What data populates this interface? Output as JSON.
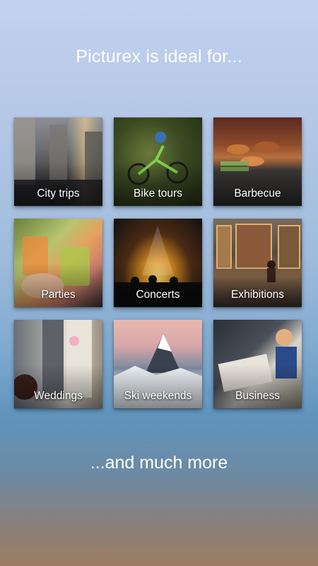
{
  "headline": "Picturex is ideal for...",
  "tiles": [
    {
      "label": "City trips"
    },
    {
      "label": "Bike tours"
    },
    {
      "label": "Barbecue"
    },
    {
      "label": "Parties"
    },
    {
      "label": "Concerts"
    },
    {
      "label": "Exhibitions"
    },
    {
      "label": "Weddings"
    },
    {
      "label": "Ski weekends"
    },
    {
      "label": "Business"
    }
  ],
  "footer": "...and much more"
}
